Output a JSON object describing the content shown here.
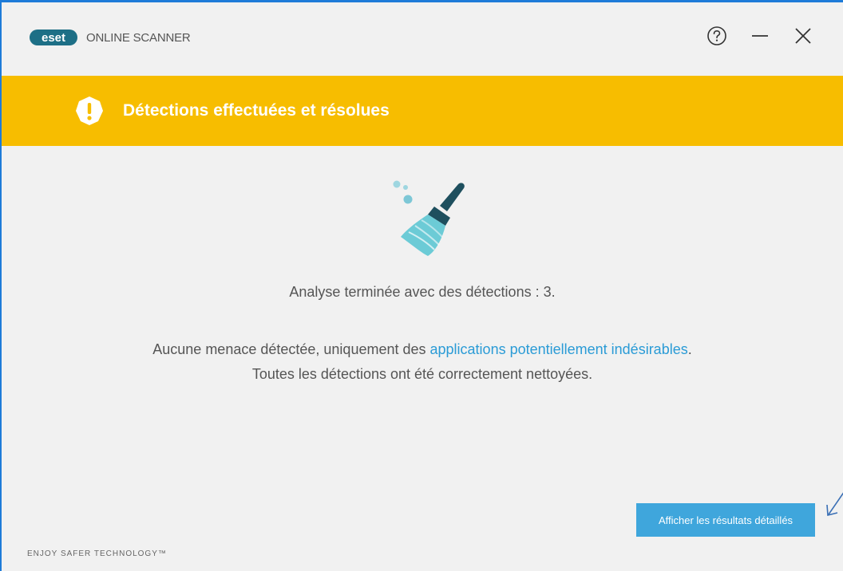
{
  "window": {
    "logo_text": "eset",
    "app_name": "ONLINE SCANNER"
  },
  "banner": {
    "title": "Détections effectuées et résolues",
    "color": "#f7bd00"
  },
  "icons": {
    "help": "help-circle-icon",
    "minimize": "minimize-icon",
    "close": "close-icon",
    "alert": "alert-shield-icon",
    "illustration": "broom-icon"
  },
  "content": {
    "summary": "Analyse terminée avec des détections : 3.",
    "detail_prefix": "Aucune menace détectée, uniquement des ",
    "detail_link": "applications potentiellement indésirables",
    "detail_suffix": ".",
    "detail_line2": "Toutes les détections ont été correctement nettoyées."
  },
  "actions": {
    "results_button": "Afficher les résultats détaillés"
  },
  "footer": {
    "tagline": "ENJOY SAFER TECHNOLOGY™"
  },
  "colors": {
    "accent": "#3fa6dc",
    "link": "#2a9bd6",
    "logo": "#1d6f86"
  }
}
